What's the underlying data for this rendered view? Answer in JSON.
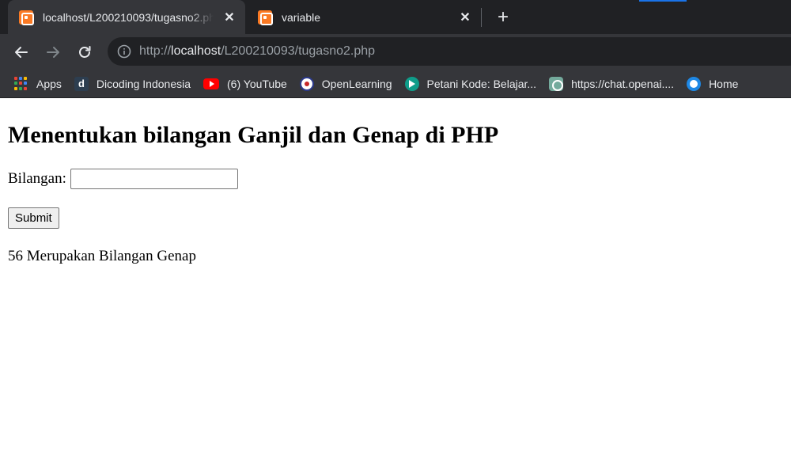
{
  "browser": {
    "tabs": [
      {
        "title": "localhost/L200210093/tugasno2.php",
        "active": true
      },
      {
        "title": "variable",
        "active": false
      }
    ],
    "new_tab_label": "+",
    "address": {
      "scheme": "http://",
      "host": "localhost",
      "path": "/L200210093/tugasno2.php"
    },
    "bookmarks": [
      {
        "label": "Apps",
        "icon": "apps-grid-icon"
      },
      {
        "label": "Dicoding Indonesia",
        "icon": "dicoding-icon"
      },
      {
        "label": "(6) YouTube",
        "icon": "youtube-icon"
      },
      {
        "label": "OpenLearning",
        "icon": "openlearning-icon"
      },
      {
        "label": "Petani Kode: Belajar...",
        "icon": "petani-kode-icon"
      },
      {
        "label": "https://chat.openai....",
        "icon": "chatgpt-icon"
      },
      {
        "label": "Home",
        "icon": "home-site-icon"
      }
    ],
    "colors": {
      "tabstrip": "#202124",
      "toolbar": "#35363a",
      "favicon": "#fb7a24"
    }
  },
  "page": {
    "heading": "Menentukan bilangan Ganjil dan Genap di PHP",
    "field_label": "Bilangan:",
    "field_value": "",
    "submit_label": "Submit",
    "result": "56 Merupakan Bilangan Genap"
  }
}
